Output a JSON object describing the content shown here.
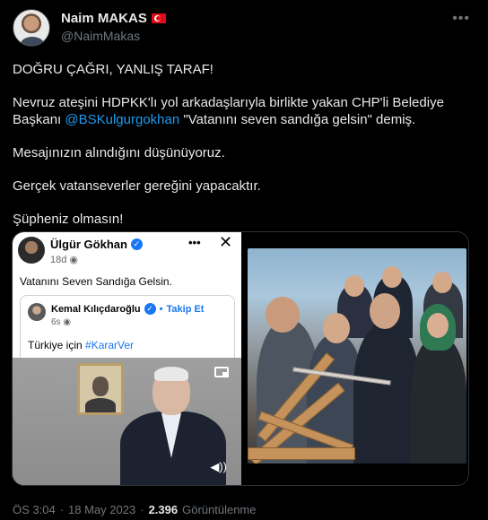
{
  "author": {
    "display_name": "Naim MAKAS",
    "handle": "@NaimMakas",
    "flag_icon": "turkey-flag-icon"
  },
  "more_icon": "more-horizontal-icon",
  "tweet": {
    "lines": [
      "DOĞRU ÇAĞRI, YANLIŞ TARAF!",
      "Mesajınızın alındığını düşünüyoruz.",
      "Gerçek vatanseverler gereğini yapacaktır.",
      "Şüpheniz olmasın!"
    ],
    "para2_part1": "Nevruz ateşini HDPKK'lı yol arkadaşlarıyla birlikte yakan CHP'li Belediye Başkanı ",
    "para2_mention": "@BSKulgurgokhan",
    "para2_part2": " \"Vatanını seven sandığa gelsin\" demiş."
  },
  "media": {
    "fb_post": {
      "author": "Ülgür Gökhan",
      "time": "18d",
      "dots": "•••",
      "close": "✕",
      "text": "Vatanını Seven Sandığa Gelsin.",
      "shared": {
        "author": "Kemal Kılıçdaroğlu",
        "follow_label": "Takip Et",
        "separator": "•",
        "time": "6s",
        "text_prefix": "Türkiye için ",
        "hashtag": "#KararVer"
      }
    }
  },
  "footer": {
    "time": "ÖS 3:04",
    "dot": "·",
    "date": "18 May 2023",
    "views_count": "2.396",
    "views_label": "Görüntülenme"
  },
  "colors": {
    "background": "#000000",
    "text": "#e7e9ea",
    "muted": "#71767b",
    "link": "#1d9bf0",
    "fb_blue": "#1877f2"
  }
}
